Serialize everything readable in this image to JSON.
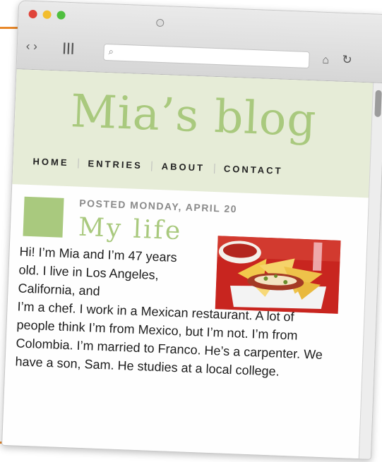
{
  "blog": {
    "title": "Mia’s blog",
    "nav": [
      "HOME",
      "ENTRIES",
      "ABOUT",
      "CONTACT"
    ]
  },
  "post": {
    "date": "POSTED MONDAY, APRIL 20",
    "title": "My life",
    "body_wrapped": "Hi! I’m Mia and I’m 47 years old. I live in Los Angeles, California, and",
    "body_rest": "I’m a chef. I work in a Mexican restaurant. A lot of people think I’m from Mexico, but I’m not. I’m from Colombia. I’m married to Franco. He’s a carpenter. We have a son, Sam. He studies at a local college."
  },
  "colors": {
    "accent_green": "#a9c97e",
    "masthead_bg": "#e6ecd7",
    "orange_callout": "#e8882a"
  }
}
